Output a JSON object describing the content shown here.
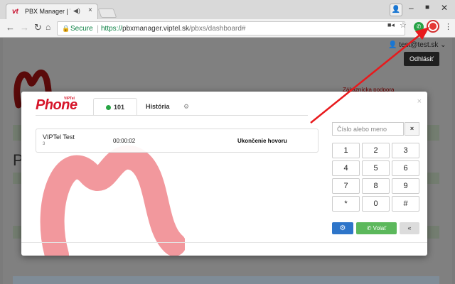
{
  "browser": {
    "tab_title": "PBX Manager | VIPTel",
    "tab_favicon": "vt",
    "secure_label": "Secure",
    "url_scheme": "https://",
    "url_host": "pbxmanager.viptel.sk",
    "url_path": "/pbxs/dashboard#",
    "icons": {
      "back": "arrow-left-icon",
      "forward": "arrow-right-icon",
      "reload": "reload-icon",
      "star": "star-icon",
      "menu": "kebab-menu-icon"
    }
  },
  "page": {
    "user_menu": "test@test.sk",
    "logout_label": "Odhlásiť",
    "support_label": "Zákaznícka podpora",
    "heading_initial": "P"
  },
  "modal": {
    "logo_text": "Phone",
    "logo_small": "VIPTel",
    "tabs": {
      "extension": "101",
      "history": "História"
    },
    "call": {
      "name": "VIPTel Test",
      "extension": "3",
      "timer": "00:00:02",
      "action": "Ukončenie hovoru"
    },
    "search_placeholder": "Číslo alebo meno",
    "clear_label": "×",
    "keys": [
      "1",
      "2",
      "3",
      "4",
      "5",
      "6",
      "7",
      "8",
      "9",
      "*",
      "0",
      "#"
    ],
    "call_label": "Volať",
    "collapse_label": "«",
    "close_label": "×"
  },
  "colors": {
    "brand_red": "#d6152a",
    "status_green": "#27a544",
    "call_green": "#5cb85c",
    "settings_blue": "#2e75c9",
    "arrow_red": "#e8191c"
  }
}
